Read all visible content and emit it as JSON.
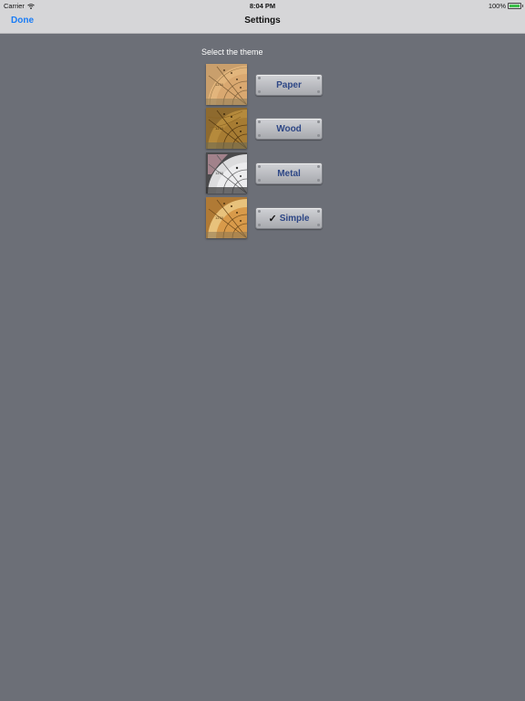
{
  "status_bar": {
    "carrier": "Carrier",
    "time": "8:04 PM",
    "battery": "100%",
    "battery_color": "#3cc04a"
  },
  "nav": {
    "done_label": "Done",
    "title": "Settings",
    "accent_color": "#1a7cf5"
  },
  "section_label": "Select the theme",
  "themes": [
    {
      "label": "Paper",
      "selected": false
    },
    {
      "label": "Wood",
      "selected": false
    },
    {
      "label": "Metal",
      "selected": false
    },
    {
      "label": "Simple",
      "selected": true
    }
  ],
  "selected_mark": "✓"
}
